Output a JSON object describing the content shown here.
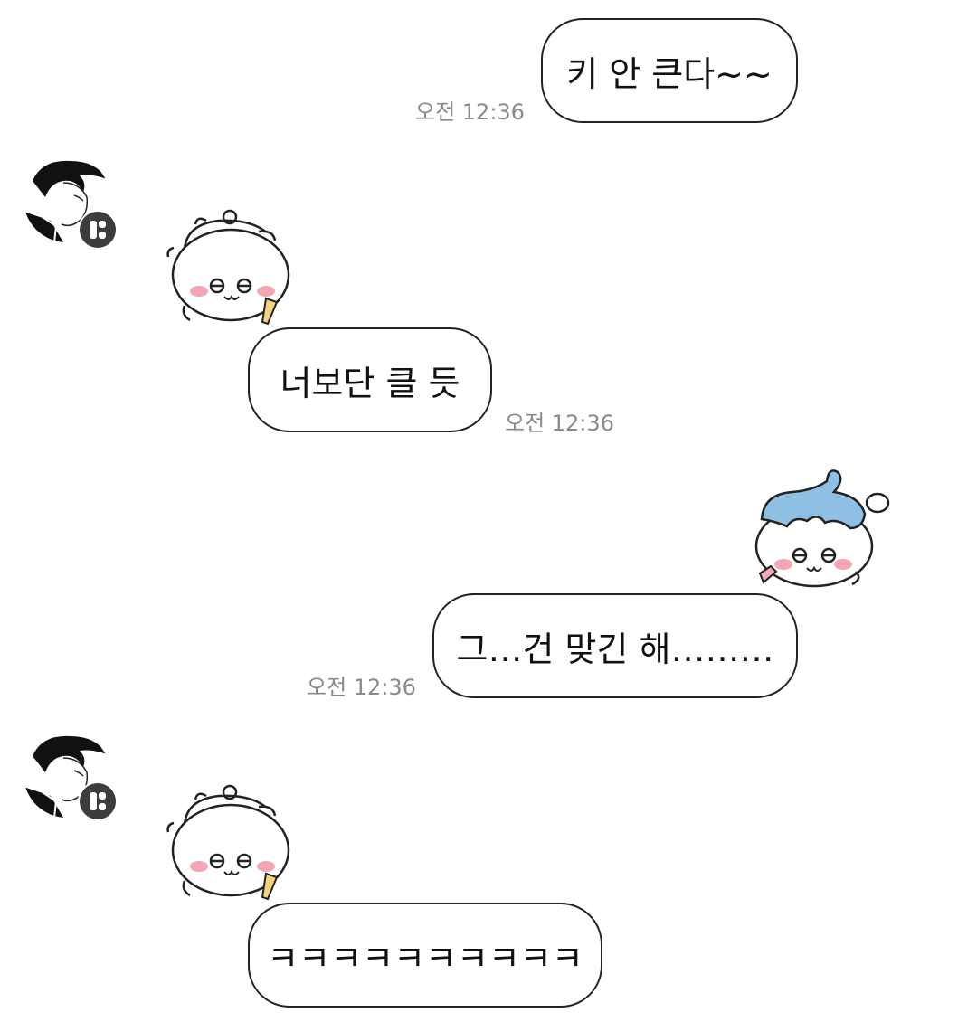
{
  "conversation": {
    "messages": [
      {
        "sender": "me",
        "text": "키 안 큰다~~",
        "time": "오전 12:36"
      },
      {
        "sender": "partner",
        "sticker": "chiikawa-thinking-sticker",
        "text": "너보단 클 듯",
        "time": "오전 12:36"
      },
      {
        "sender": "me",
        "sticker": "hachiware-thinking-sticker",
        "text": "그…건 맞긴 해………",
        "time": "오전 12:36"
      },
      {
        "sender": "partner",
        "sticker": "chiikawa-thinking-sticker",
        "text": "ㅋㅋㅋㅋㅋㅋㅋㅋㅋㅋ"
      }
    ]
  },
  "colors": {
    "bubble_border": "#222222",
    "bubble_bg": "#ffffff",
    "time_text": "#8a8a8a",
    "hachiware_hat": "#8fc0e3",
    "blush": "#f3a7b5",
    "pencil": "#f3d37d"
  }
}
